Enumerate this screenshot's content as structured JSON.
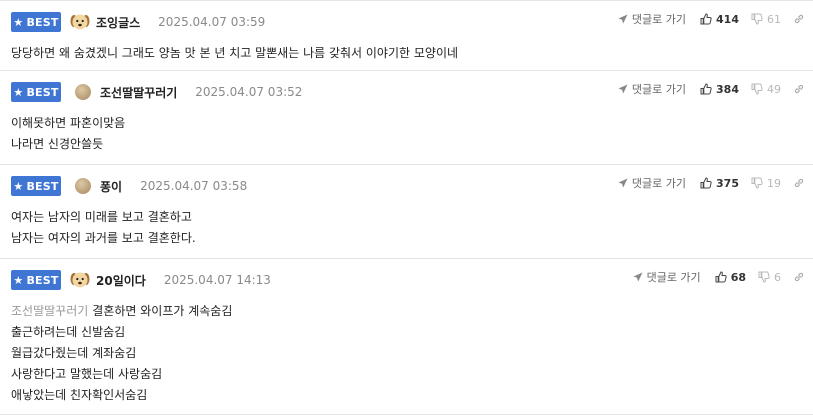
{
  "badge": {
    "label": "BEST"
  },
  "actions": {
    "reply_label": "댓글로 가기"
  },
  "comments": [
    {
      "nickname": "조잉글스",
      "avatar": "dog-icon",
      "date": "2025.04.07 03:59",
      "likes": "414",
      "dislikes": "61",
      "mention": "",
      "lines": [
        "당당하면 왜 숨겼겠니 그래도 양놈 맛 본 년 치고 말뽄새는 나름 갖춰서 이야기한 모양이네"
      ]
    },
    {
      "nickname": "조선딸딸꾸러기",
      "avatar": "dot-icon",
      "date": "2025.04.07 03:52",
      "likes": "384",
      "dislikes": "49",
      "mention": "",
      "lines": [
        "이해못하면 파혼이맞음",
        "나라면 신경안쓸듯"
      ]
    },
    {
      "nickname": "퐁이",
      "avatar": "dot-icon",
      "date": "2025.04.07 03:58",
      "likes": "375",
      "dislikes": "19",
      "mention": "",
      "lines": [
        "여자는 남자의 미래를 보고 결혼하고",
        "남자는 여자의 과거를 보고 결혼한다."
      ]
    },
    {
      "nickname": "20일이다",
      "avatar": "dog-icon",
      "date": "2025.04.07 14:13",
      "likes": "68",
      "dislikes": "6",
      "mention": "조선딸딸꾸러기",
      "lines": [
        "결혼하면 와이프가 계속숨김",
        "출근하려는데 신발숨김",
        "월급갔다줬는데 계좌숨김",
        "사랑한다고 말했는데 사랑숨김",
        "애낳았는데 친자확인서숨김"
      ]
    }
  ],
  "colors": {
    "badge_bg": "#3f76d3",
    "divider": "#e3e3e3",
    "date": "#8a8a8a",
    "mention": "#9a9a9a"
  }
}
